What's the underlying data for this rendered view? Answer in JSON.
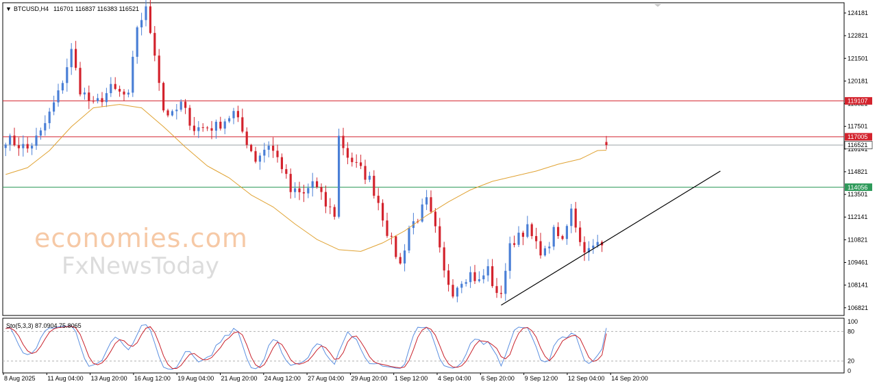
{
  "header": {
    "menu_arrow": "▼",
    "symbol": "BTCUSD,H4",
    "ohlc": "116701 116837 116383 116521"
  },
  "oscillator": {
    "label": "Sto(5,3,3) 87.0904 75.8065"
  },
  "watermark": {
    "line1": "economies.com",
    "line2": "FxNewsToday"
  },
  "colors": {
    "bull": "#4a7fd6",
    "bear": "#d3232d",
    "ma": "#e0a232",
    "resistance": "#d3232d",
    "support": "#2e9a5a",
    "trend": "#000000",
    "stoch_main": "#5b8fe0",
    "stoch_signal": "#c8202a"
  },
  "chart_data": [
    {
      "type": "candlestick",
      "symbol": "BTCUSD",
      "timeframe": "H4",
      "x_tick_labels": [
        "8 Aug 2025",
        "11 Aug 04:00",
        "13 Aug 20:00",
        "16 Aug 12:00",
        "19 Aug 04:00",
        "21 Aug 20:00",
        "24 Aug 12:00",
        "27 Aug 04:00",
        "29 Aug 20:00",
        "1 Sep 12:00",
        "4 Sep 04:00",
        "6 Sep 20:00",
        "9 Sep 12:00",
        "12 Sep 04:00",
        "14 Sep 20:00"
      ],
      "y_tick_labels": [
        "124181",
        "122821",
        "121501",
        "120181",
        "118821",
        "117501",
        "116141",
        "114821",
        "113501",
        "112141",
        "110821",
        "109461",
        "108141",
        "106821"
      ],
      "ylim": [
        106550,
        124850
      ],
      "n_bars": 138,
      "anchors": [
        [
          0,
          116900
        ],
        [
          5,
          116300
        ],
        [
          8,
          117200
        ],
        [
          12,
          119500
        ],
        [
          15,
          122000
        ],
        [
          17,
          119800
        ],
        [
          20,
          118800
        ],
        [
          24,
          119800
        ],
        [
          28,
          119300
        ],
        [
          30,
          123500
        ],
        [
          32,
          124400
        ],
        [
          34,
          122000
        ],
        [
          36,
          118600
        ],
        [
          38,
          118200
        ],
        [
          40,
          118900
        ],
        [
          43,
          117500
        ],
        [
          48,
          117600
        ],
        [
          52,
          118400
        ],
        [
          54,
          117300
        ],
        [
          57,
          115700
        ],
        [
          60,
          116600
        ],
        [
          63,
          115300
        ],
        [
          65,
          113800
        ],
        [
          68,
          113600
        ],
        [
          70,
          114400
        ],
        [
          73,
          113000
        ],
        [
          75,
          112500
        ],
        [
          76,
          117000
        ],
        [
          78,
          115900
        ],
        [
          80,
          115300
        ],
        [
          83,
          114500
        ],
        [
          85,
          113200
        ],
        [
          87,
          111500
        ],
        [
          90,
          109500
        ],
        [
          92,
          111700
        ],
        [
          94,
          112300
        ],
        [
          96,
          113200
        ],
        [
          98,
          111500
        ],
        [
          100,
          109000
        ],
        [
          102,
          108000
        ],
        [
          104,
          108700
        ],
        [
          106,
          109000
        ],
        [
          108,
          108500
        ],
        [
          110,
          109300
        ],
        [
          112,
          107600
        ],
        [
          113,
          108000
        ],
        [
          115,
          110500
        ],
        [
          117,
          111400
        ],
        [
          119,
          111600
        ],
        [
          121,
          110600
        ],
        [
          123,
          110200
        ],
        [
          125,
          111400
        ],
        [
          127,
          110900
        ],
        [
          129,
          113000
        ],
        [
          131,
          110800
        ],
        [
          133,
          110300
        ],
        [
          135,
          110700
        ]
      ],
      "ohlc_last": {
        "open": 116701,
        "high": 116837,
        "low": 116383,
        "close": 116521
      },
      "moving_average": {
        "anchors": [
          [
            0,
            114800
          ],
          [
            5,
            115200
          ],
          [
            10,
            116200
          ],
          [
            15,
            117600
          ],
          [
            20,
            118700
          ],
          [
            26,
            118900
          ],
          [
            31,
            118700
          ],
          [
            36,
            117600
          ],
          [
            41,
            116400
          ],
          [
            46,
            115300
          ],
          [
            51,
            114600
          ],
          [
            56,
            113600
          ],
          [
            61,
            112900
          ],
          [
            66,
            111900
          ],
          [
            71,
            111000
          ],
          [
            76,
            110400
          ],
          [
            81,
            110300
          ],
          [
            86,
            110800
          ],
          [
            91,
            111500
          ],
          [
            96,
            112400
          ],
          [
            101,
            113200
          ],
          [
            106,
            113900
          ],
          [
            111,
            114400
          ],
          [
            116,
            114700
          ],
          [
            121,
            115000
          ],
          [
            126,
            115400
          ],
          [
            131,
            115700
          ],
          [
            135,
            116200
          ]
        ]
      },
      "horizontal_lines": [
        {
          "label": "119107",
          "value": 119107,
          "color": "#d3232d"
        },
        {
          "label": "117005",
          "value": 117005,
          "color": "#d3232d"
        },
        {
          "label": "116521",
          "value": 116521,
          "color": "#9aa0a6"
        },
        {
          "label": "114056",
          "value": 114056,
          "color": "#2e9a5a"
        }
      ],
      "trendline": {
        "from": {
          "bar": 113,
          "price": 107150
        },
        "to": {
          "bar": 163,
          "price": 115000
        }
      }
    },
    {
      "type": "line",
      "name": "Sto(5,3,3)",
      "main": 87.0904,
      "signal": 75.8065,
      "ylim": [
        0,
        100
      ],
      "y_tick_labels": [
        "100",
        "80",
        "20",
        "0"
      ],
      "levels": [
        80,
        20
      ]
    }
  ]
}
